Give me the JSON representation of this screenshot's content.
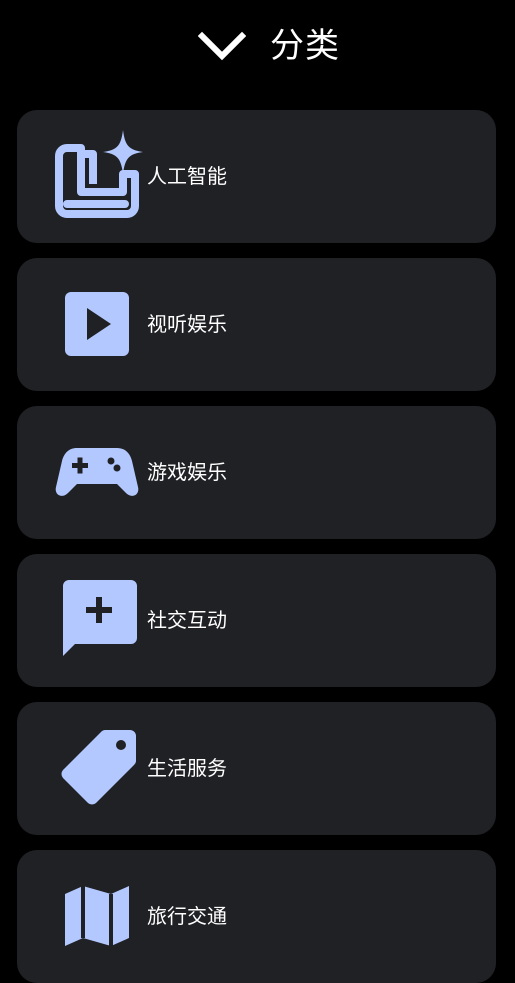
{
  "header": {
    "title": "分类",
    "collapse_icon": "chevron-down-icon"
  },
  "accent_color": "#b3c8ff",
  "card_color": "#202125",
  "categories": [
    {
      "label": "人工智能",
      "icon": "ai-sparkle-icon"
    },
    {
      "label": "视听娱乐",
      "icon": "play-icon"
    },
    {
      "label": "游戏娱乐",
      "icon": "gamepad-icon"
    },
    {
      "label": "社交互动",
      "icon": "chat-add-icon"
    },
    {
      "label": "生活服务",
      "icon": "tag-icon"
    },
    {
      "label": "旅行交通",
      "icon": "map-icon"
    }
  ]
}
